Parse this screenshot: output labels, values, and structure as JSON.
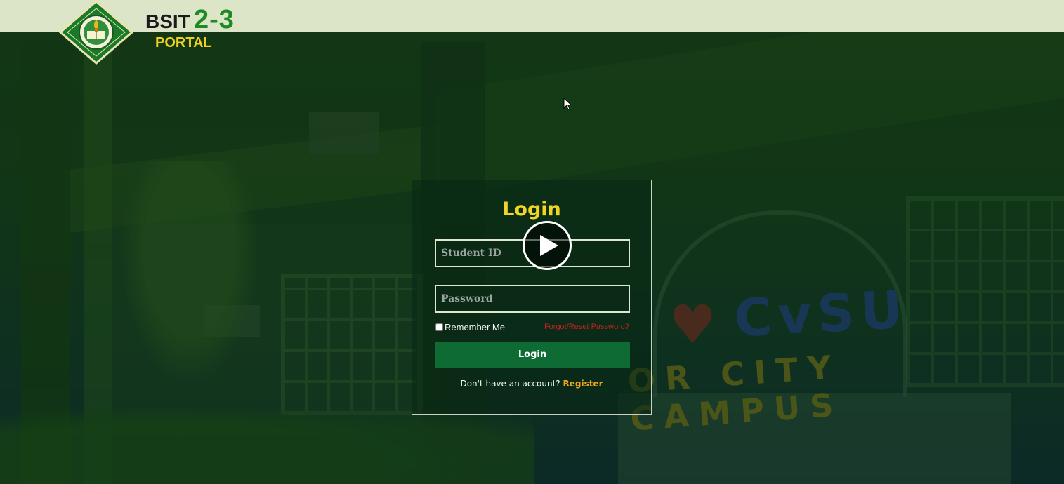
{
  "header": {
    "brand_bsit": "BSIT",
    "brand_num": "2-3",
    "brand_portal": "PORTAL",
    "logo_icon": "university-seal-logo"
  },
  "background": {
    "sign_cvsu": "CvSU",
    "sign_campus": "OR CITY CAMPUS",
    "heart_icon": "heart"
  },
  "login": {
    "title": "Login",
    "student_id_placeholder": "Student ID",
    "password_placeholder": "Password",
    "remember_label": "Remember Me",
    "remember_checked": false,
    "forgot_link": "Forgot/Reset Password?",
    "submit_label": "Login",
    "no_account_text": "Don't have an account?",
    "register_link": "Register"
  },
  "overlay": {
    "play_icon": "play-icon"
  },
  "colors": {
    "header_bg": "#dce5c7",
    "title_yellow": "#f1d524",
    "button_green": "#0e6b33",
    "forgot_red": "#c7201c",
    "register_orange": "#f0a81a",
    "brand_green": "#1e8a24",
    "portal_yellow": "#f0d21e"
  }
}
